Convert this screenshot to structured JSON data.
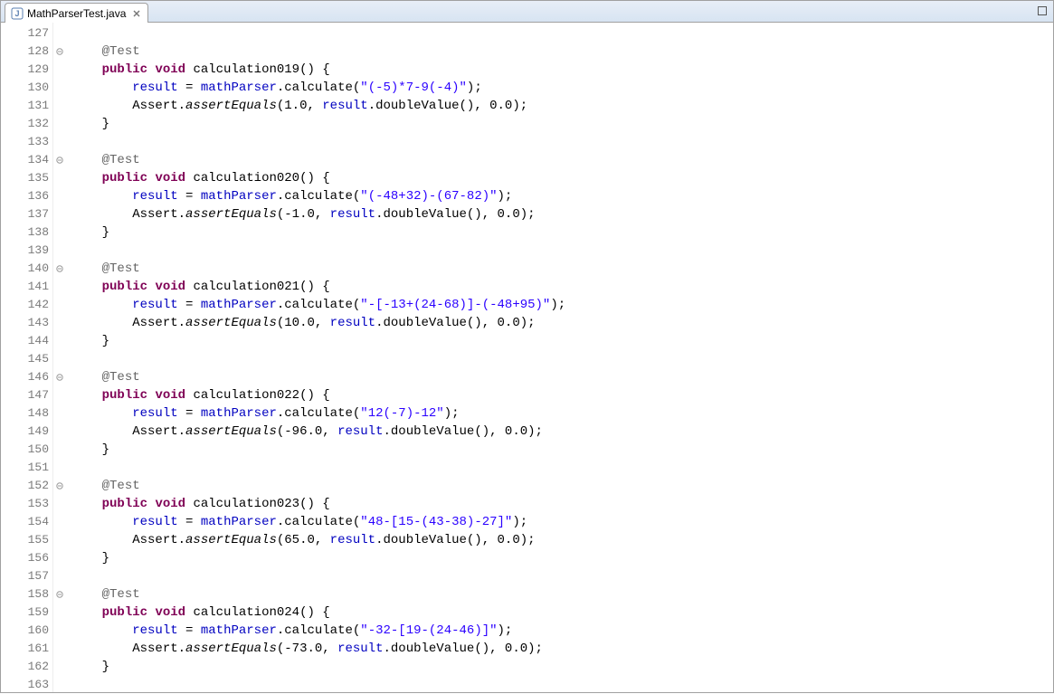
{
  "tab": {
    "filename": "MathParserTest.java"
  },
  "first_line_number": 127,
  "fold_lines": [
    128,
    134,
    140,
    146,
    152,
    158
  ],
  "methods": [
    {
      "name": "calculation019",
      "expr": "\"(-5)*7-9(-4)\"",
      "expected": "1.0"
    },
    {
      "name": "calculation020",
      "expr": "\"(-48+32)-(67-82)\"",
      "expected": "-1.0"
    },
    {
      "name": "calculation021",
      "expr": "\"-[-13+(24-68)]-(-48+95)\"",
      "expected": "10.0"
    },
    {
      "name": "calculation022",
      "expr": "\"12(-7)-12\"",
      "expected": "-96.0"
    },
    {
      "name": "calculation023",
      "expr": "\"48-[15-(43-38)-27]\"",
      "expected": "65.0"
    },
    {
      "name": "calculation024",
      "expr": "\"-32-[19-(24-46)]\"",
      "expected": "-73.0"
    }
  ],
  "tokens": {
    "annotation": "@Test",
    "kw_public": "public",
    "kw_void": "void",
    "field_result": "result",
    "field_parser": "mathParser",
    "m_calculate": "calculate",
    "cls_assert": "Assert",
    "m_assertEquals": "assertEquals",
    "m_doubleValue": "doubleValue",
    "delta": "0.0"
  }
}
